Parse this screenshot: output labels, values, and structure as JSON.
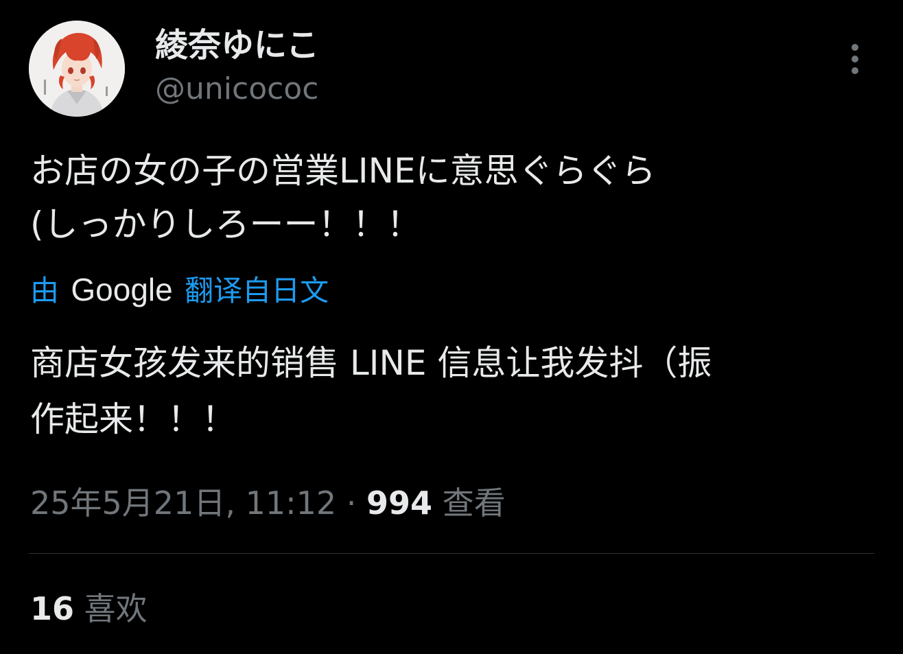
{
  "author": {
    "display_name": "綾奈ゆにこ",
    "handle": "@unicococ"
  },
  "tweet": {
    "text": "お店の女の子の営業LINEに意思ぐらぐら\n(しっかりしろーー！！！",
    "translation_prefix": "由",
    "translation_provider": "Google",
    "translation_suffix": "翻译自日文",
    "translated_text": "商店女孩发来的销售 LINE 信息让我发抖（振\n作起来！！！"
  },
  "meta": {
    "timestamp": "25年5月21日, 11:12",
    "separator": "·",
    "views_count": "994",
    "views_label": "查看"
  },
  "stats": {
    "likes_count": "16",
    "likes_label": "喜欢"
  },
  "icons": {
    "more": "more-vertical-icon",
    "avatar": "avatar-image"
  },
  "colors": {
    "background": "#000000",
    "primary_text": "#e7e9ea",
    "secondary_text": "#71767b",
    "accent": "#1d9bf0",
    "divider": "#2f3336"
  }
}
